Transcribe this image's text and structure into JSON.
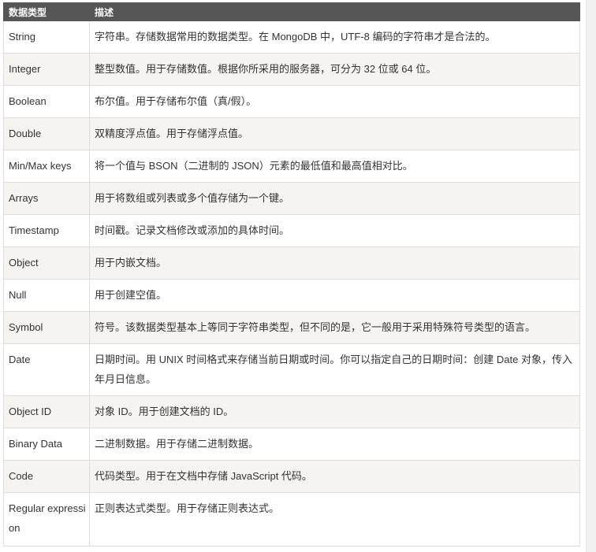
{
  "table": {
    "headers": {
      "type": "数据类型",
      "desc": "描述"
    },
    "rows": [
      {
        "type": "String",
        "desc": "字符串。存储数据常用的数据类型。在 MongoDB 中，UTF-8 编码的字符串才是合法的。"
      },
      {
        "type": "Integer",
        "desc": "整型数值。用于存储数值。根据你所采用的服务器，可分为 32 位或 64 位。"
      },
      {
        "type": "Boolean",
        "desc": "布尔值。用于存储布尔值（真/假）。"
      },
      {
        "type": "Double",
        "desc": "双精度浮点值。用于存储浮点值。"
      },
      {
        "type": "Min/Max keys",
        "desc": "将一个值与 BSON（二进制的 JSON）元素的最低值和最高值相对比。"
      },
      {
        "type": "Arrays",
        "desc": "用于将数组或列表或多个值存储为一个键。"
      },
      {
        "type": "Timestamp",
        "desc": "时间戳。记录文档修改或添加的具体时间。"
      },
      {
        "type": "Object",
        "desc": "用于内嵌文档。"
      },
      {
        "type": "Null",
        "desc": "用于创建空值。"
      },
      {
        "type": "Symbol",
        "desc": "符号。该数据类型基本上等同于字符串类型，但不同的是，它一般用于采用特殊符号类型的语言。"
      },
      {
        "type": "Date",
        "desc": "日期时间。用 UNIX 时间格式来存储当前日期或时间。你可以指定自己的日期时间：创建 Date 对象，传入年月日信息。"
      },
      {
        "type": "Object ID",
        "desc": "对象 ID。用于创建文档的 ID。"
      },
      {
        "type": "Binary Data",
        "desc": "二进制数据。用于存储二进制数据。"
      },
      {
        "type": "Code",
        "desc": "代码类型。用于在文档中存储 JavaScript 代码。"
      },
      {
        "type": "Regular expression",
        "desc": "正则表达式类型。用于存储正则表达式。"
      }
    ]
  }
}
